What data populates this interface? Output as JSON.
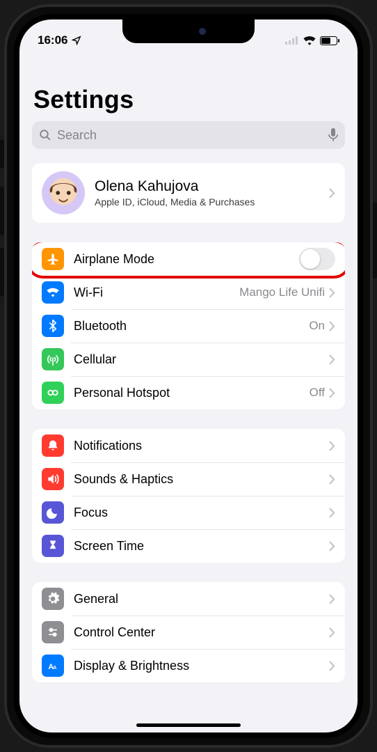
{
  "status": {
    "time": "16:06"
  },
  "title": "Settings",
  "search": {
    "placeholder": "Search"
  },
  "profile": {
    "name": "Olena Kahujova",
    "subtitle": "Apple ID, iCloud, Media & Purchases"
  },
  "connectivity": {
    "airplane": {
      "label": "Airplane Mode",
      "on": false
    },
    "wifi": {
      "label": "Wi-Fi",
      "detail": "Mango Life Unifi"
    },
    "bluetooth": {
      "label": "Bluetooth",
      "detail": "On"
    },
    "cellular": {
      "label": "Cellular"
    },
    "hotspot": {
      "label": "Personal Hotspot",
      "detail": "Off"
    }
  },
  "alerts": {
    "notifications": {
      "label": "Notifications"
    },
    "sounds": {
      "label": "Sounds & Haptics"
    },
    "focus": {
      "label": "Focus"
    },
    "screentime": {
      "label": "Screen Time"
    }
  },
  "general_group": {
    "general": {
      "label": "General"
    },
    "control": {
      "label": "Control Center"
    },
    "display": {
      "label": "Display & Brightness"
    }
  }
}
